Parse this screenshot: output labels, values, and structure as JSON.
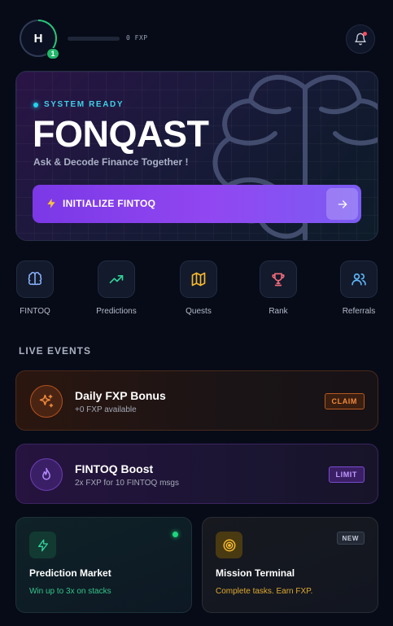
{
  "header": {
    "avatar_initial": "H",
    "level": "1",
    "xp_text": "0 FXP",
    "xp_progress": 0,
    "bell_icon": "bell-icon"
  },
  "hero": {
    "status": "SYSTEM READY",
    "title": "FONQAST",
    "subtitle": "Ask & Decode Finance Together !",
    "cta_label": "INITIALIZE FINTOQ",
    "cta_icon": "lightning-icon",
    "cta_arrow_icon": "arrow-right-icon",
    "background_icon": "brain-icon"
  },
  "quick_nav": [
    {
      "label": "FINTOQ",
      "icon": "brain-icon",
      "color": "#8ab4ff"
    },
    {
      "label": "Predictions",
      "icon": "trending-up-icon",
      "color": "#34d399"
    },
    {
      "label": "Quests",
      "icon": "map-icon",
      "color": "#f5b82e"
    },
    {
      "label": "Rank",
      "icon": "trophy-icon",
      "color": "#f26b7a"
    },
    {
      "label": "Referrals",
      "icon": "users-icon",
      "color": "#5fb3f5"
    }
  ],
  "live_events": {
    "title": "LIVE EVENTS",
    "items": [
      {
        "title": "Daily FXP Bonus",
        "subtitle": "+0 FXP available",
        "action": "CLAIM",
        "icon": "sparkles-icon"
      },
      {
        "title": "FINTOQ Boost",
        "subtitle": "2x FXP for 10 FINTOQ msgs",
        "action": "LIMIT",
        "icon": "flame-icon"
      }
    ]
  },
  "tiles": [
    {
      "title": "Prediction Market",
      "subtitle": "Win up to 3x on stacks",
      "icon": "lightning-icon",
      "indicator": "live"
    },
    {
      "title": "Mission Terminal",
      "subtitle": "Complete tasks. Earn FXP.",
      "icon": "target-icon",
      "badge": "NEW"
    }
  ],
  "colors": {
    "background": "#070b17",
    "accent_purple": "#8b45ef",
    "accent_cyan": "#22d3ee",
    "accent_green": "#29c47a",
    "accent_orange": "#f08a3c"
  }
}
